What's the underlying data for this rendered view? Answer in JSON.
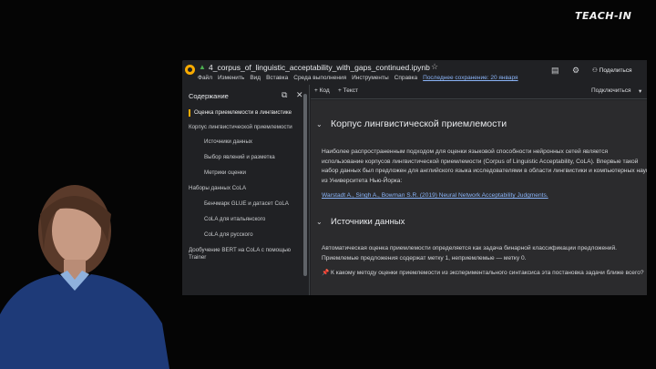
{
  "brand": "TEACH-IN",
  "notebook": {
    "filename": "4_corpus_of_linguistic_acceptability_with_gaps_continued.ipynb",
    "menu": [
      "Файл",
      "Изменить",
      "Вид",
      "Вставка",
      "Среда выполнения",
      "Инструменты",
      "Справка"
    ],
    "last_saved": "Последнее сохранение: 20 января",
    "share_label": "Поделиться"
  },
  "sidebar": {
    "title": "Содержание",
    "items": [
      {
        "label": "Оценка приемлемости в лингвистике",
        "level": 1,
        "active": true
      },
      {
        "label": "Корпус лингвистической приемлемости",
        "level": 1
      },
      {
        "label": "Источники данных",
        "level": 2
      },
      {
        "label": "Выбор явлений и разметка",
        "level": 2
      },
      {
        "label": "Метрики оценки",
        "level": 2
      },
      {
        "label": "Наборы данных CoLA",
        "level": 1
      },
      {
        "label": "Бенчмарк GLUE и датасет CoLA",
        "level": 2
      },
      {
        "label": "CoLA для итальянского",
        "level": 2
      },
      {
        "label": "CoLA для русского",
        "level": 2
      },
      {
        "label": "Дообучение BERT на CoLA с помощью Trainer",
        "level": 1
      }
    ]
  },
  "toolbar": {
    "add_code": "+ Код",
    "add_text": "+ Текст",
    "connect": "Подключиться"
  },
  "content": {
    "heading1": "Корпус лингвистической приемлемости",
    "para1": "Наиболее распространенным подходом для оценки языковой способности нейронных сетей является использование корпусов лингвистической приемлемости (Corpus of Linguistic Acceptability, CoLA). Впервые такой набор данных был предложен для английского языка исследователями в области лингвистики и компьютерных наук из Университета Нью-Йорка:",
    "link": "Warstadt A., Singh A., Bowman S.R. (2019) Neural Network Acceptability Judgments.",
    "heading2": "Источники данных",
    "para2": "Автоматическая оценка приемлемости определяется как задача бинарной классификации предложений. Приемлемые предложения содержат метку 1, неприемлемые — метку 0.",
    "question": "К какому методу оценки приемлемости из экспериментального синтаксиса эта постановка задачи ближе всего?"
  }
}
